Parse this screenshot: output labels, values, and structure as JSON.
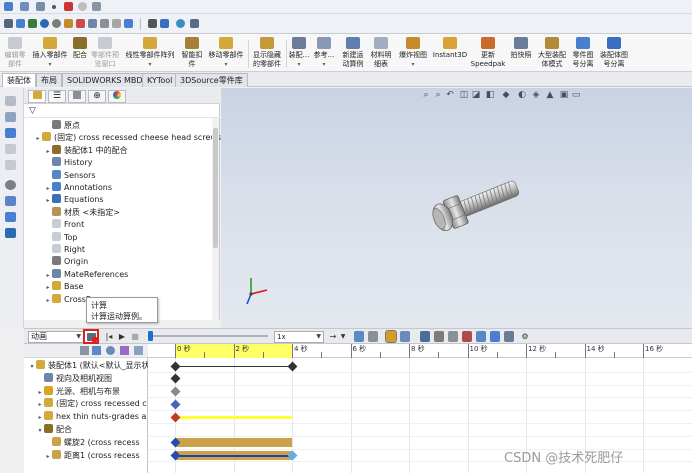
{
  "ribbon": {
    "buttons": [
      {
        "label1": "编辑零",
        "label2": "部件",
        "dim": true
      },
      {
        "label1": "插入零部件",
        "label2": "▾",
        "dim": false
      },
      {
        "label1": "配合",
        "label2": "",
        "dim": false
      },
      {
        "label1": "零部件预",
        "label2": "览窗口",
        "dim": true
      },
      {
        "label1": "线性零部件阵列",
        "label2": "▾",
        "dim": false
      },
      {
        "label1": "智能扣",
        "label2": "件",
        "dim": false
      },
      {
        "label1": "移动零部件",
        "label2": "▾",
        "dim": false
      },
      {
        "label1": "显示隐藏",
        "label2": "的零部件",
        "dim": false
      },
      {
        "label1": "装配...",
        "label2": "▾",
        "dim": false
      },
      {
        "label1": "参考...",
        "label2": "▾",
        "dim": false
      },
      {
        "label1": "新建运",
        "label2": "动算例",
        "dim": false
      },
      {
        "label1": "材料明",
        "label2": "细表",
        "dim": false
      },
      {
        "label1": "爆炸视图",
        "label2": "▾",
        "dim": false
      },
      {
        "label1": "Instant3D",
        "label2": "",
        "dim": false
      },
      {
        "label1": "更新",
        "label2": "Speedpak",
        "dim": false
      },
      {
        "label1": "拍快照",
        "label2": "",
        "dim": false
      },
      {
        "label1": "大型装配",
        "label2": "体模式",
        "dim": false
      },
      {
        "label1": "零件图",
        "label2": "号分离",
        "dim": false
      },
      {
        "label1": "装配体图",
        "label2": "号分离",
        "dim": false
      }
    ]
  },
  "tabs": [
    {
      "label": "装配体",
      "active": true
    },
    {
      "label": "布局",
      "active": false
    },
    {
      "label": "SOLIDWORKS MBD",
      "active": false
    },
    {
      "label": "KYTool",
      "active": false
    },
    {
      "label": "3DSource零件库",
      "active": false
    }
  ],
  "tree": {
    "items": [
      {
        "label": "原点",
        "indent": 1,
        "exp": "",
        "color": "#7a7a7a"
      },
      {
        "label": "(固定) cross recessed cheese head screws g",
        "indent": 0,
        "exp": "▸",
        "color": "#d4a93a"
      },
      {
        "label": "装配体1 中的配合",
        "indent": 1,
        "exp": "▸",
        "color": "#8b6d2a"
      },
      {
        "label": "History",
        "indent": 1,
        "exp": "",
        "color": "#6f86a8"
      },
      {
        "label": "Sensors",
        "indent": 1,
        "exp": "",
        "color": "#5a86c8"
      },
      {
        "label": "Annotations",
        "indent": 1,
        "exp": "▸",
        "color": "#4a7ed0"
      },
      {
        "label": "Equations",
        "indent": 1,
        "exp": "▸",
        "color": "#3a6fbf"
      },
      {
        "label": "材质 <未指定>",
        "indent": 1,
        "exp": "",
        "color": "#b69458"
      },
      {
        "label": "Front",
        "indent": 1,
        "exp": "",
        "color": "#c7ccd5"
      },
      {
        "label": "Top",
        "indent": 1,
        "exp": "",
        "color": "#c7ccd5"
      },
      {
        "label": "Right",
        "indent": 1,
        "exp": "",
        "color": "#c7ccd5"
      },
      {
        "label": "Origin",
        "indent": 1,
        "exp": "",
        "color": "#7a7a7a"
      },
      {
        "label": "MateReferences",
        "indent": 1,
        "exp": "▸",
        "color": "#6f86a8"
      },
      {
        "label": "Base",
        "indent": 1,
        "exp": "▸",
        "color": "#d4a93a"
      },
      {
        "label": "CrossRec",
        "indent": 1,
        "exp": "▸",
        "color": "#d4a93a"
      }
    ]
  },
  "tooltip": {
    "title": "计算",
    "desc": "计算运动算例。"
  },
  "motion": {
    "study_type": "动画",
    "playback_speed": "1x"
  },
  "mm_tree": {
    "items": [
      {
        "label": "装配体1 (默认<默认_显示状",
        "indent": 0,
        "exp": "▾",
        "color": "#d4a93a"
      },
      {
        "label": "视向及相机视图",
        "indent": 1,
        "exp": "",
        "color": "#6f86a8"
      },
      {
        "label": "光源、相机与布景",
        "indent": 1,
        "exp": "▸",
        "color": "#e0a020"
      },
      {
        "label": "(固定) cross recessed c",
        "indent": 1,
        "exp": "▸",
        "color": "#d4a93a"
      },
      {
        "label": "hex thin nuts-grades a",
        "indent": 1,
        "exp": "▸",
        "color": "#d4a93a"
      },
      {
        "label": "配合",
        "indent": 1,
        "exp": "▾",
        "color": "#8b6d2a"
      },
      {
        "label": "螺旋2 (cross recess",
        "indent": 2,
        "exp": "",
        "color": "#c9a24a"
      },
      {
        "label": "距离1 (cross recess",
        "indent": 2,
        "exp": "▸",
        "color": "#c9a24a"
      }
    ]
  },
  "timeline": {
    "ticks": [
      "0 秒",
      "2 秒",
      "4 秒",
      "6 秒",
      "8 秒",
      "10 秒",
      "12 秒",
      "14 秒",
      "16 秒"
    ],
    "duration": 4,
    "key_end": 4
  },
  "watermark": "CSDN @技术死肥仔",
  "colors": {
    "accent": "#1f6fd0",
    "highlight": "#e0201c",
    "yellow_bar": "#ffff33",
    "tan_bar": "#c9a24a"
  }
}
